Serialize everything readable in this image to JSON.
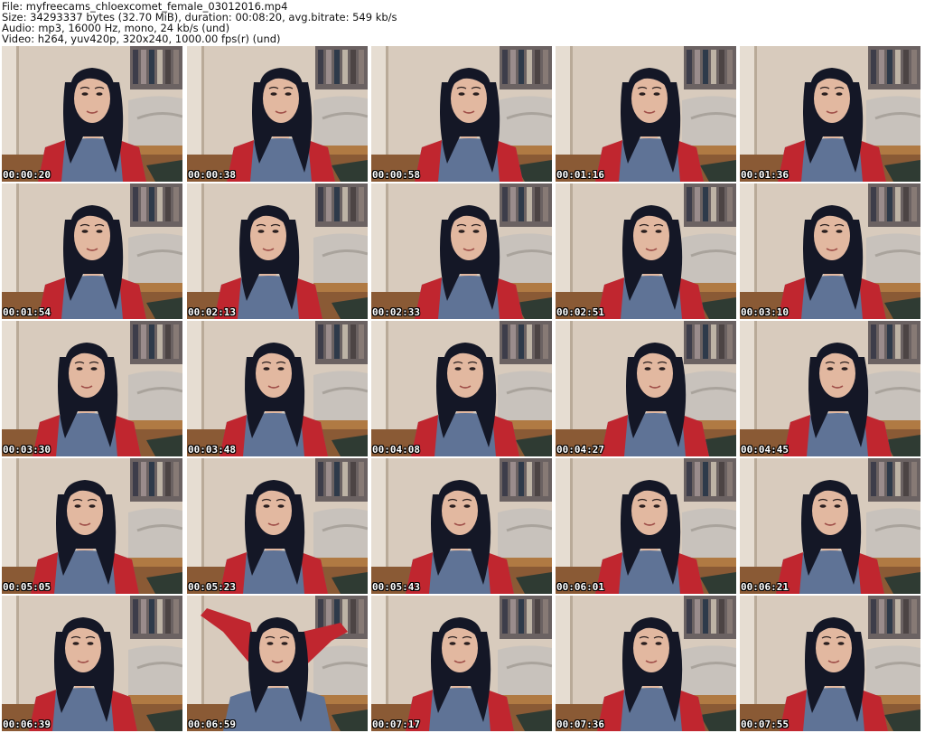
{
  "info": {
    "file": "File: myfreecams_chloexcomet_female_03012016.mp4",
    "size": "Size: 34293337 bytes (32.70 MiB), duration: 00:08:20, avg.bitrate: 549 kb/s",
    "audio": "Audio: mp3, 16000 Hz, mono, 24 kb/s (und)",
    "video": "Video: h264, yuv420p, 320x240, 1000.00 fps(r) (und)"
  },
  "thumbnails": [
    {
      "timestamp": "00:00:20"
    },
    {
      "timestamp": "00:00:38"
    },
    {
      "timestamp": "00:00:58"
    },
    {
      "timestamp": "00:01:16"
    },
    {
      "timestamp": "00:01:36"
    },
    {
      "timestamp": "00:01:54"
    },
    {
      "timestamp": "00:02:13"
    },
    {
      "timestamp": "00:02:33"
    },
    {
      "timestamp": "00:02:51"
    },
    {
      "timestamp": "00:03:10"
    },
    {
      "timestamp": "00:03:30"
    },
    {
      "timestamp": "00:03:48"
    },
    {
      "timestamp": "00:04:08"
    },
    {
      "timestamp": "00:04:27"
    },
    {
      "timestamp": "00:04:45"
    },
    {
      "timestamp": "00:05:05"
    },
    {
      "timestamp": "00:05:23"
    },
    {
      "timestamp": "00:05:43"
    },
    {
      "timestamp": "00:06:01"
    },
    {
      "timestamp": "00:06:21"
    },
    {
      "timestamp": "00:06:39"
    },
    {
      "timestamp": "00:06:59"
    },
    {
      "timestamp": "00:07:17"
    },
    {
      "timestamp": "00:07:36"
    },
    {
      "timestamp": "00:07:55"
    }
  ],
  "colors": {
    "wall": "#d8cbbd",
    "hair": "#141726",
    "skin": "#e2b8a0",
    "shirt_sleeve": "#c0262f",
    "shirt_body": "#5f7396",
    "floor": "#8a5a35",
    "bedding": "#c8c2bc"
  }
}
